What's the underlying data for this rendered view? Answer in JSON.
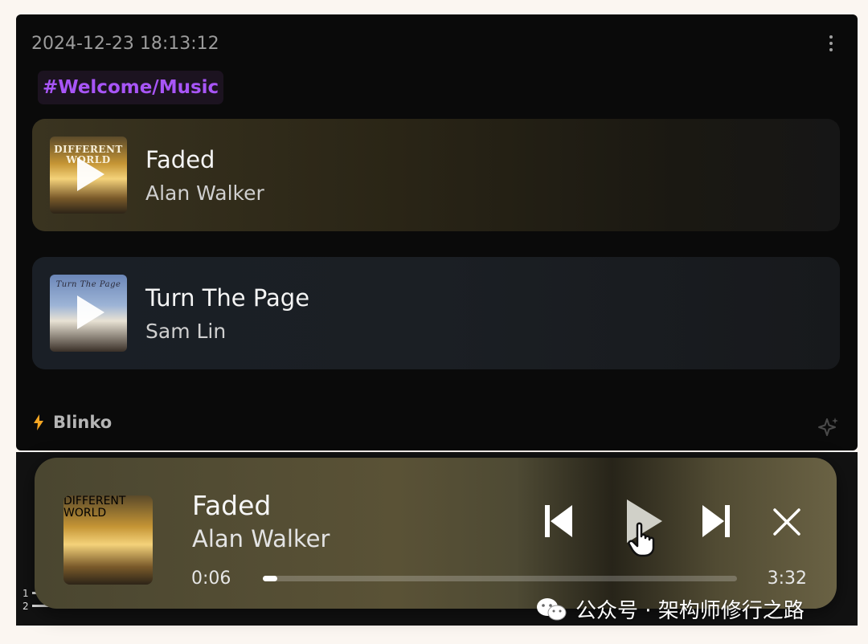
{
  "note": {
    "timestamp": "2024-12-23 18:13:12",
    "tag": "#Welcome/Music",
    "songs": [
      {
        "title": "Faded",
        "artist": "Alan Walker",
        "cover_text": "DIFFERENT WORLD"
      },
      {
        "title": "Turn The Page",
        "artist": "Sam Lin",
        "cover_text": "Turn The Page"
      }
    ],
    "brand": "Blinko",
    "icons": {
      "menu": "kebab-menu-icon",
      "brand": "lightning-icon",
      "ai": "sparkle-icon"
    }
  },
  "player": {
    "title": "Faded",
    "artist": "Alan Walker",
    "cover_text": "DIFFERENT WORLD",
    "current_time": "0:06",
    "total_time": "3:32",
    "progress": 0.03,
    "icons": [
      "previous-icon",
      "play-icon",
      "next-icon",
      "close-icon"
    ]
  },
  "watermark": {
    "text": "公众号 · 架构师修行之路",
    "icon": "wechat-icon"
  },
  "colors": {
    "tag": "#a855f7",
    "brand_bolt": "#f5a623",
    "card_bg": "#0a0a0a"
  }
}
